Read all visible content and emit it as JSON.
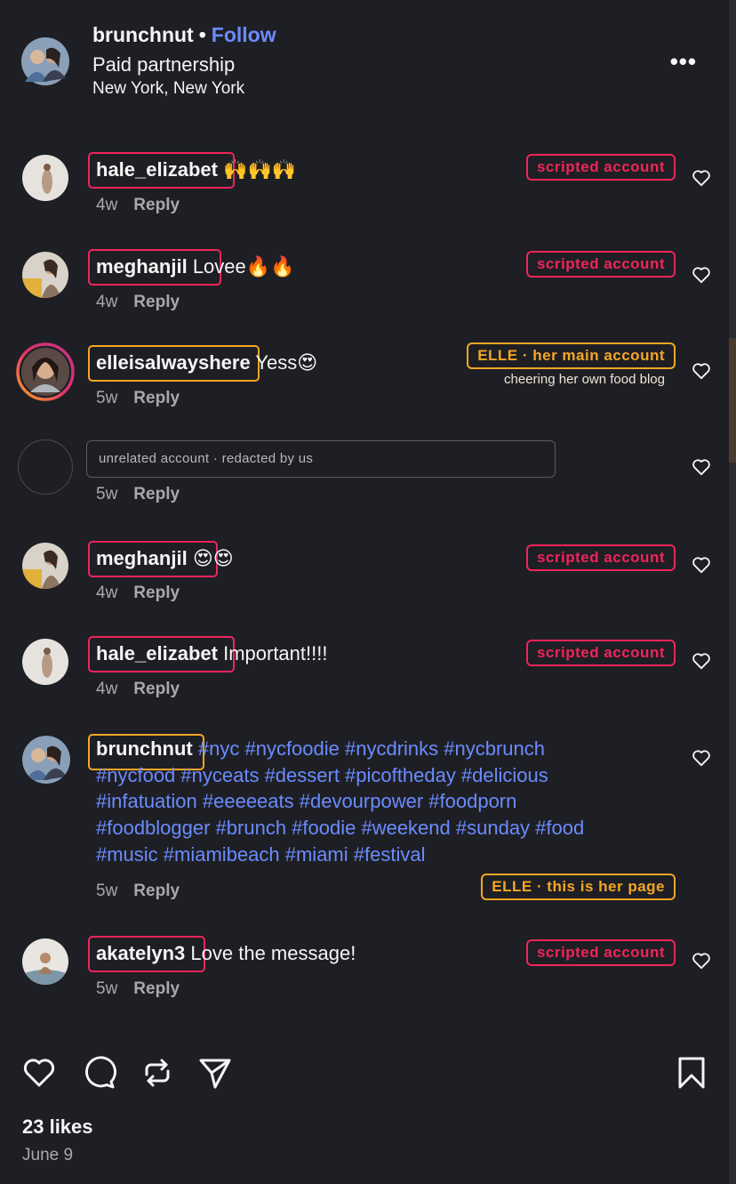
{
  "header": {
    "username": "brunchnut",
    "separator": "•",
    "follow_label": "Follow",
    "partnership": "Paid partnership",
    "location": "New York, New York",
    "more_icon": "more-horizontal-icon"
  },
  "comments": [
    {
      "username": "hale_elizabet",
      "text": "🙌🙌🙌",
      "time": "4w",
      "reply": "Reply",
      "tag": "scripted account"
    },
    {
      "username": "meghanjil",
      "text": "Lovee🔥🔥",
      "time": "4w",
      "reply": "Reply",
      "tag": "scripted account"
    },
    {
      "username": "elleisalwayshere",
      "text": "Yess😍",
      "time": "5w",
      "reply": "Reply",
      "tag": "ELLE · her main account",
      "note": "cheering her own food blog"
    },
    {
      "redacted_label": "unrelated account · redacted by us",
      "time": "5w",
      "reply": "Reply"
    },
    {
      "username": "meghanjil",
      "text": "😍😍",
      "time": "4w",
      "reply": "Reply",
      "tag": "scripted account"
    },
    {
      "username": "hale_elizabet",
      "text": "Important!!!!",
      "time": "4w",
      "reply": "Reply",
      "tag": "scripted account"
    },
    {
      "username": "brunchnut",
      "time": "5w",
      "reply": "Reply",
      "tag": "ELLE · this is her page",
      "hashtag_lines": [
        "#nyc #nycfoodie #nycdrinks #nycbrunch",
        "#nycfood #nyceats #dessert #picoftheday #delicious",
        "#infatuation #eeeeeats #devourpower #foodporn",
        "#foodblogger #brunch #foodie #weekend #sunday #food",
        "#music #miamibeach #miami #festival"
      ]
    },
    {
      "username": "akatelyn3",
      "text": "Love the message!",
      "time": "5w",
      "reply": "Reply",
      "tag": "scripted account"
    }
  ],
  "actions": {
    "like_icon": "heart-icon",
    "comment_icon": "comment-icon",
    "repost_icon": "repost-icon",
    "share_icon": "send-icon",
    "save_icon": "bookmark-icon"
  },
  "likes": "23 likes",
  "date": "June 9",
  "colors": {
    "background": "#1e1f24",
    "scripted_tag": "#f0245b",
    "elle_tag": "#f5a623",
    "link_blue": "#6b8bff",
    "muted": "#a9a9ad"
  }
}
